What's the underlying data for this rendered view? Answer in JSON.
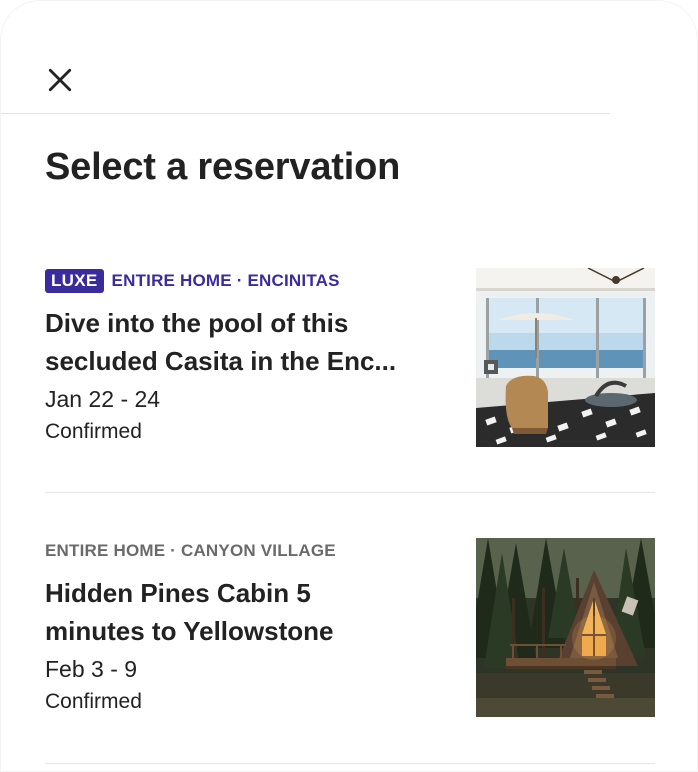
{
  "header": {
    "title": "Select a reservation",
    "close_icon": "close-icon"
  },
  "reservations": [
    {
      "badge": "LUXE",
      "meta": "ENTIRE HOME · ENCINITAS",
      "title_line1": "Dive into the pool of this",
      "title_line2": "secluded Casita in the Enc...",
      "dates": "Jan 22 - 24",
      "status": "Confirmed",
      "accent": "#3a2c9c"
    },
    {
      "meta": "ENTIRE HOME · CANYON VILLAGE",
      "title_line1": "Hidden Pines Cabin 5",
      "title_line2": "minutes to Yellowstone",
      "dates": "Feb 3 - 9",
      "status": "Confirmed"
    }
  ]
}
